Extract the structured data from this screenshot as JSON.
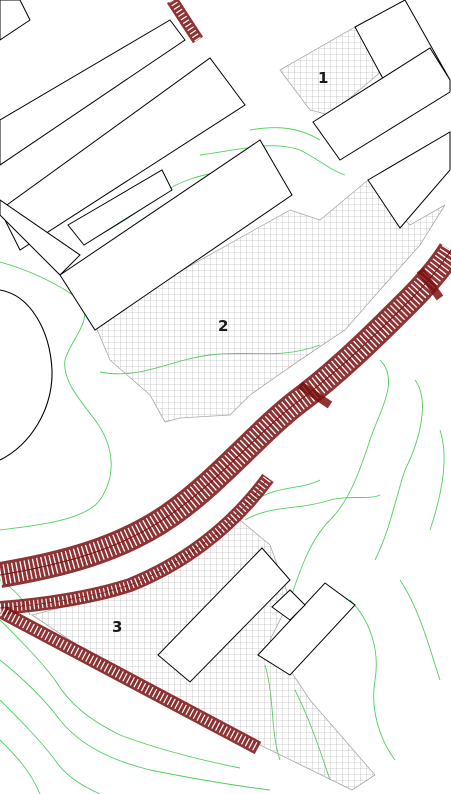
{
  "map": {
    "zones": [
      {
        "label": "1"
      },
      {
        "label": "2"
      },
      {
        "label": "3"
      }
    ],
    "colors": {
      "background": "#ffffff",
      "building_outline": "#000000",
      "contour_line": "#44cc55",
      "hatch": "#9a9a9a",
      "rail": "#7a1010"
    }
  }
}
